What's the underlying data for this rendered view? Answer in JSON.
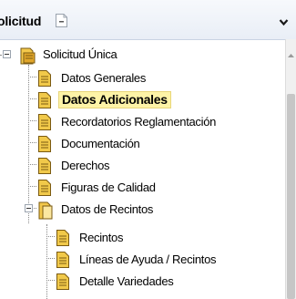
{
  "header": {
    "title": "olicitud",
    "icon": "page-minimize-icon",
    "chevron": "chevron-down-icon"
  },
  "tree": {
    "root": {
      "label": "Solicitud Única",
      "icon": "folder-open-icon"
    },
    "items": [
      {
        "label": "Datos Generales",
        "icon": "document-icon"
      },
      {
        "label": "Datos Adicionales",
        "icon": "document-icon",
        "selected": true
      },
      {
        "label": "Recordatorios Reglamentación",
        "icon": "document-icon"
      },
      {
        "label": "Documentación",
        "icon": "document-icon"
      },
      {
        "label": "Derechos",
        "icon": "document-icon"
      },
      {
        "label": "Figuras de Calidad",
        "icon": "document-icon"
      },
      {
        "label": "Datos de Recintos",
        "icon": "folder-open-icon"
      }
    ],
    "sub_items": [
      {
        "label": "Recintos",
        "icon": "document-icon"
      },
      {
        "label": "Líneas de Ayuda / Recintos",
        "icon": "document-icon"
      },
      {
        "label": "Detalle Variedades",
        "icon": "document-icon"
      }
    ]
  },
  "colors": {
    "selected_bg": "#fdf3a7",
    "folder": "#e0a52a",
    "document": "#f1c94a"
  }
}
